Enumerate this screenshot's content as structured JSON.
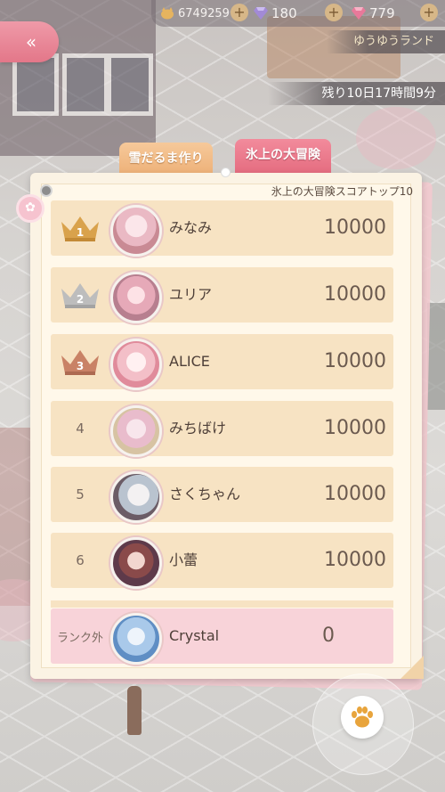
{
  "top_bar": {
    "gold": "6749259",
    "diamonds": "180",
    "stars": "779",
    "gold_icon": "coin-cat-icon",
    "diamond_icon": "purple-diamond-icon",
    "star_icon": "pink-gem-icon"
  },
  "header": {
    "back_icon": "double-chevron-left-icon",
    "location": "ゆうゆうランド",
    "time_remaining": "残り10日17時間9分"
  },
  "tabs": [
    {
      "label": "雪だるま作り",
      "active": false
    },
    {
      "label": "氷上の大冒険",
      "active": true
    }
  ],
  "board": {
    "title": "氷上の大冒険スコアトップ10"
  },
  "rows": [
    {
      "rank": "1",
      "name": "みなみ",
      "score": "10000",
      "medal": "gold"
    },
    {
      "rank": "2",
      "name": "ユリア",
      "score": "10000",
      "medal": "silver"
    },
    {
      "rank": "3",
      "name": "ALICE",
      "score": "10000",
      "medal": "bronze"
    },
    {
      "rank": "4",
      "name": "みちばけ",
      "score": "10000",
      "medal": ""
    },
    {
      "rank": "5",
      "name": "さくちゃん",
      "score": "10000",
      "medal": ""
    },
    {
      "rank": "6",
      "name": "小蕾",
      "score": "10000",
      "medal": ""
    }
  ],
  "me": {
    "rank": "ランク外",
    "name": "Crystal",
    "score": "0"
  },
  "colors": {
    "gold": "#d9a24c",
    "silver": "#b9b9b9",
    "bronze": "#c98266",
    "accent_pink": "#e56d80",
    "row_bg": "#f7e3c3"
  },
  "paw_icon": "paw-icon"
}
